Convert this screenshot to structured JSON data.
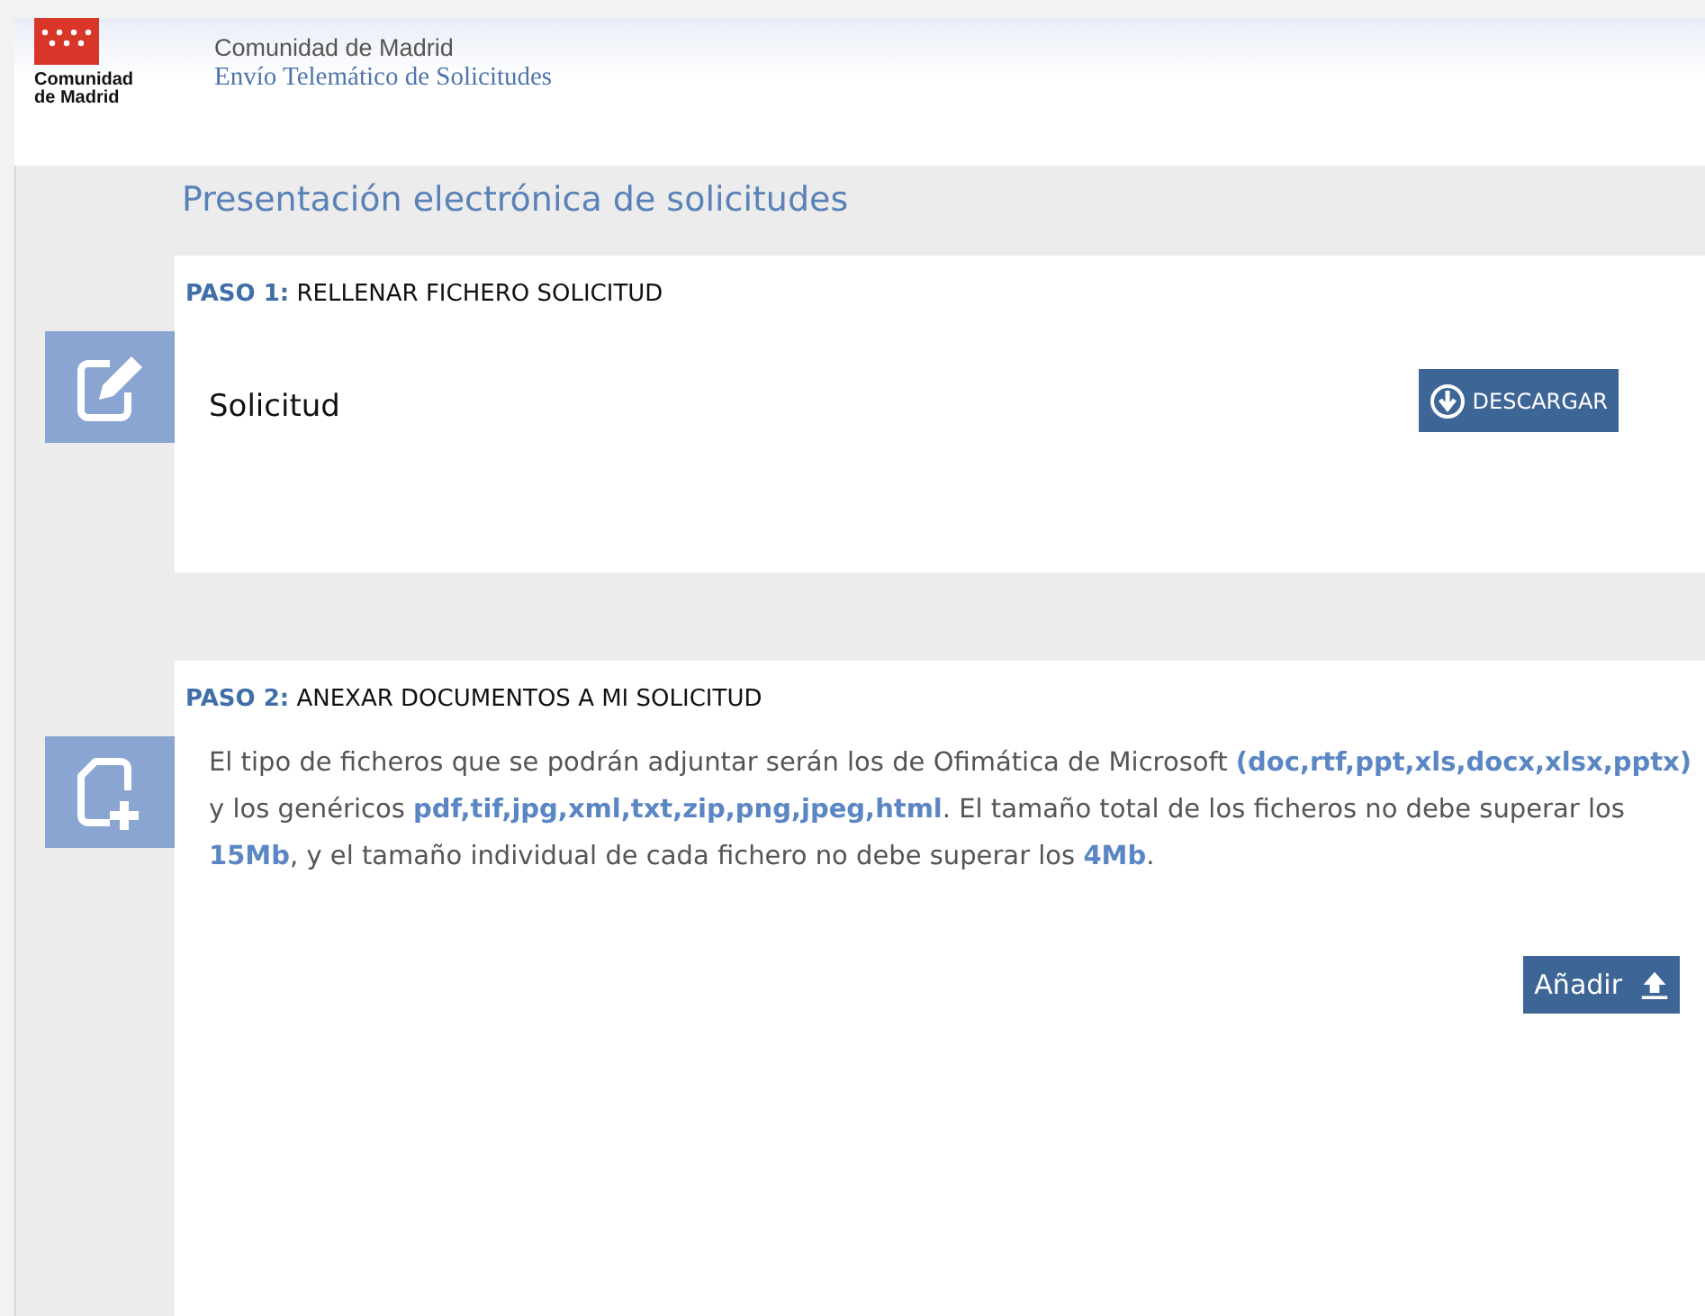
{
  "header": {
    "logo_text": "Comunidad de Madrid",
    "org": "Comunidad de Madrid",
    "app_title": "Envío Telemático de Solicitudes"
  },
  "page_title": "Presentación electrónica de solicitudes",
  "steps": [
    {
      "kind": "download",
      "step_label": "PASO 1:",
      "title": "RELLENAR FICHERO SOLICITUD",
      "item": "Solicitud",
      "button": "DESCARGAR"
    },
    {
      "kind": "upload",
      "step_label": "PASO 2:",
      "title": "ANEXAR DOCUMENTOS A MI SOLICITUD",
      "description": "El tipo de ficheros que se podrán adjuntar serán los de Ofimática de Microsoft **(doc,rtf,ppt,xls,docx,xlsx,pptx)** y los genéricos **pdf,tif,jpg,xml,txt,zip,png,jpeg,html**. El tamaño total de los ficheros no debe superar los **15Mb**, y el tamaño individual de cada fichero no debe superar los **4Mb**.",
      "button": "Añadir"
    }
  ]
}
